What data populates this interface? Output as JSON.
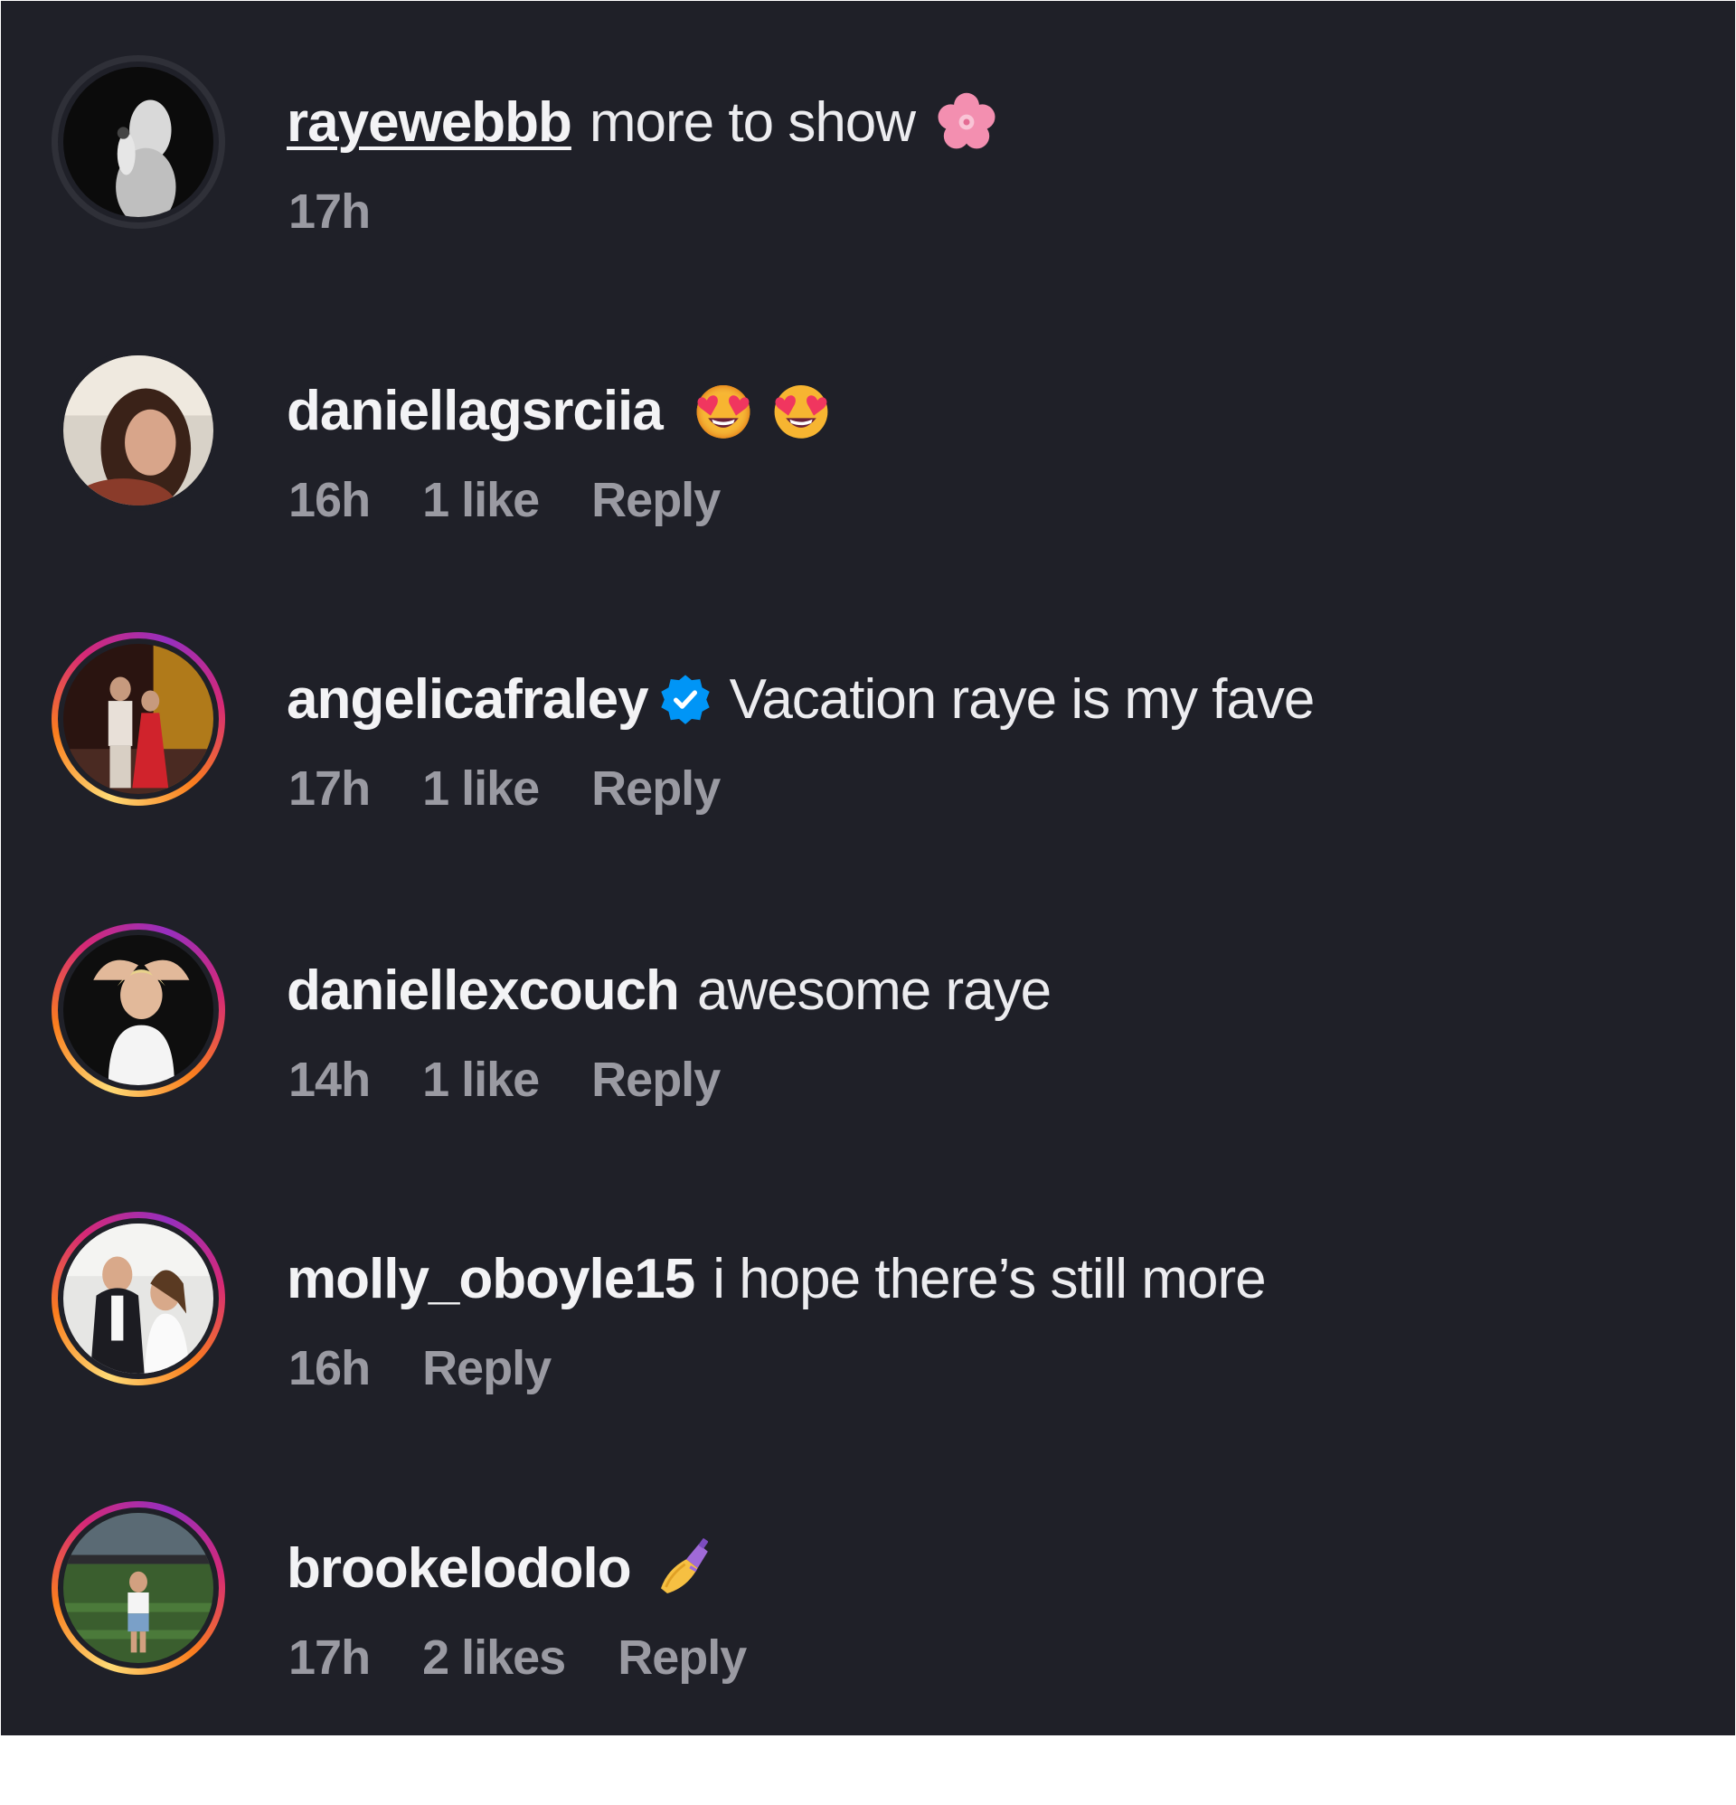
{
  "comments": [
    {
      "username": "rayewebbb",
      "text": "more to show",
      "emoji": "cherry-blossom",
      "time": "17h",
      "likes": "",
      "reply": ""
    },
    {
      "username": "daniellagsrciia",
      "text": "",
      "emoji": "heart-eyes x2",
      "time": "16h",
      "likes": "1 like",
      "reply": "Reply"
    },
    {
      "username": "angelicafraley",
      "verified": true,
      "text": "Vacation raye is my fave",
      "time": "17h",
      "likes": "1 like",
      "reply": "Reply"
    },
    {
      "username": "daniellexcouch",
      "text": "awesome raye",
      "time": "14h",
      "likes": "1 like",
      "reply": "Reply"
    },
    {
      "username": "molly_oboyle15",
      "text": "i hope there’s still more",
      "time": "16h",
      "likes": "",
      "reply": "Reply"
    },
    {
      "username": "brookelodolo",
      "text": "",
      "emoji": "nail-polish",
      "time": "17h",
      "likes": "2 likes",
      "reply": "Reply"
    }
  ],
  "colors": {
    "background": "#1f2028",
    "username": "#f3f3f5",
    "meta": "#9a9aa2",
    "verified": "#0095f6"
  }
}
